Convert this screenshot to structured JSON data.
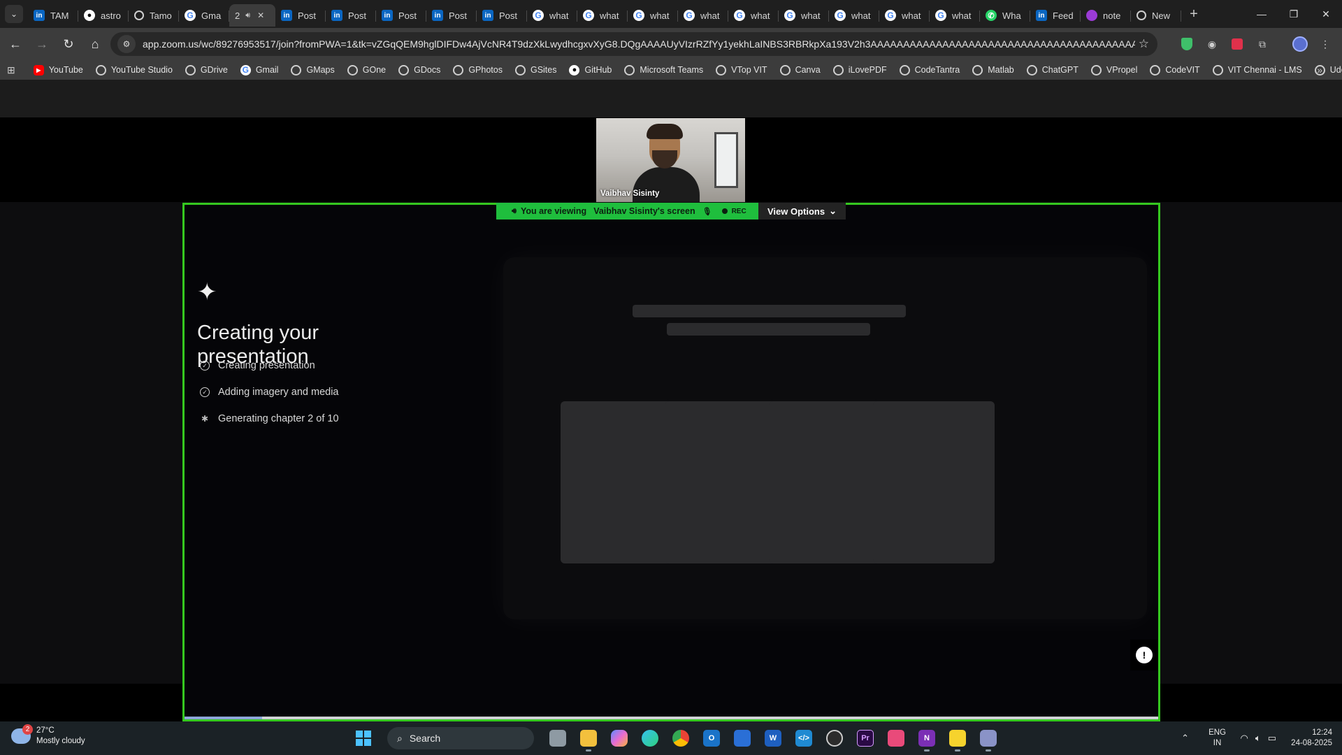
{
  "browser": {
    "tabs": [
      {
        "title": "TAM",
        "icon": "linkedin-icon"
      },
      {
        "title": "astro",
        "icon": "github-icon"
      },
      {
        "title": "Tamo",
        "icon": "globe-icon"
      },
      {
        "title": "Gma",
        "icon": "google-icon"
      },
      {
        "title": "2",
        "icon": "audio-icon",
        "active": true
      },
      {
        "title": "Post",
        "icon": "linkedin-icon"
      },
      {
        "title": "Post",
        "icon": "linkedin-icon"
      },
      {
        "title": "Post",
        "icon": "linkedin-icon"
      },
      {
        "title": "Post",
        "icon": "linkedin-icon"
      },
      {
        "title": "Post",
        "icon": "linkedin-icon"
      },
      {
        "title": "what",
        "icon": "google-icon"
      },
      {
        "title": "what",
        "icon": "google-icon"
      },
      {
        "title": "what",
        "icon": "google-icon"
      },
      {
        "title": "what",
        "icon": "google-icon"
      },
      {
        "title": "what",
        "icon": "google-icon"
      },
      {
        "title": "what",
        "icon": "google-icon"
      },
      {
        "title": "what",
        "icon": "google-icon"
      },
      {
        "title": "what",
        "icon": "google-icon"
      },
      {
        "title": "what",
        "icon": "google-icon"
      },
      {
        "title": "Wha",
        "icon": "whatsapp-icon"
      },
      {
        "title": "Feed",
        "icon": "linkedin-icon"
      },
      {
        "title": "note",
        "icon": "notebook-icon"
      },
      {
        "title": "New",
        "icon": "globe-icon"
      }
    ],
    "url": "app.zoom.us/wc/89276953517/join?fromPWA=1&tk=vZGqQEM9hglDIFDw4AjVcNR4T9dzXkLwydhcgxvXyG8.DQgAAAAUyVIzrRZfYy1yekhLaINBS3RBRkpXa193V2h3AAAAAAAAAAAAAAAAAAAAAAAAAAAAAAAAAAAAAAAAAA&_x_zm_r..."
  },
  "bookmarks": [
    {
      "label": "YouTube",
      "icon": "youtube-icon"
    },
    {
      "label": "YouTube Studio",
      "icon": "globe-icon"
    },
    {
      "label": "GDrive",
      "icon": "globe-icon"
    },
    {
      "label": "Gmail",
      "icon": "google-icon"
    },
    {
      "label": "GMaps",
      "icon": "globe-icon"
    },
    {
      "label": "GOne",
      "icon": "globe-icon"
    },
    {
      "label": "GDocs",
      "icon": "globe-icon"
    },
    {
      "label": "GPhotos",
      "icon": "globe-icon"
    },
    {
      "label": "GSites",
      "icon": "globe-icon"
    },
    {
      "label": "GitHub",
      "icon": "github-icon"
    },
    {
      "label": "Microsoft Teams",
      "icon": "globe-icon"
    },
    {
      "label": "VTop VIT",
      "icon": "globe-icon"
    },
    {
      "label": "Canva",
      "icon": "globe-icon"
    },
    {
      "label": "iLovePDF",
      "icon": "globe-icon"
    },
    {
      "label": "CodeTantra",
      "icon": "globe-icon"
    },
    {
      "label": "Matlab",
      "icon": "globe-icon"
    },
    {
      "label": "ChatGPT",
      "icon": "chatgpt-icon"
    },
    {
      "label": "VPropel",
      "icon": "globe-icon"
    },
    {
      "label": "CodeVIT",
      "icon": "globe-icon"
    },
    {
      "label": "VIT Chennai - LMS",
      "icon": "globe-icon"
    },
    {
      "label": "Udemy",
      "icon": "globe-icon"
    }
  ],
  "zoom": {
    "participant_name": "Vaibhav Sisinty",
    "banner_prefix": "You are viewing",
    "banner_name": "Vaibhav Sisinty's screen",
    "rec_label": "REC",
    "view_options": "View Options",
    "share_border_color": "#35c81f"
  },
  "slide": {
    "title": "Creating your presentation",
    "steps": [
      {
        "label": "Creating presentation",
        "icon": "check-circle-icon"
      },
      {
        "label": "Adding imagery and media",
        "icon": "check-circle-icon"
      },
      {
        "label": "Generating chapter 2 of 10",
        "icon": "loading-icon"
      }
    ],
    "progress_fraction": 0.08
  },
  "taskbar": {
    "weather_badge": "2",
    "temperature": "27°C",
    "condition": "Mostly cloudy",
    "search_label": "Search",
    "language": "ENG",
    "region": "IN",
    "time": "12:24",
    "date": "24-08-2025"
  }
}
